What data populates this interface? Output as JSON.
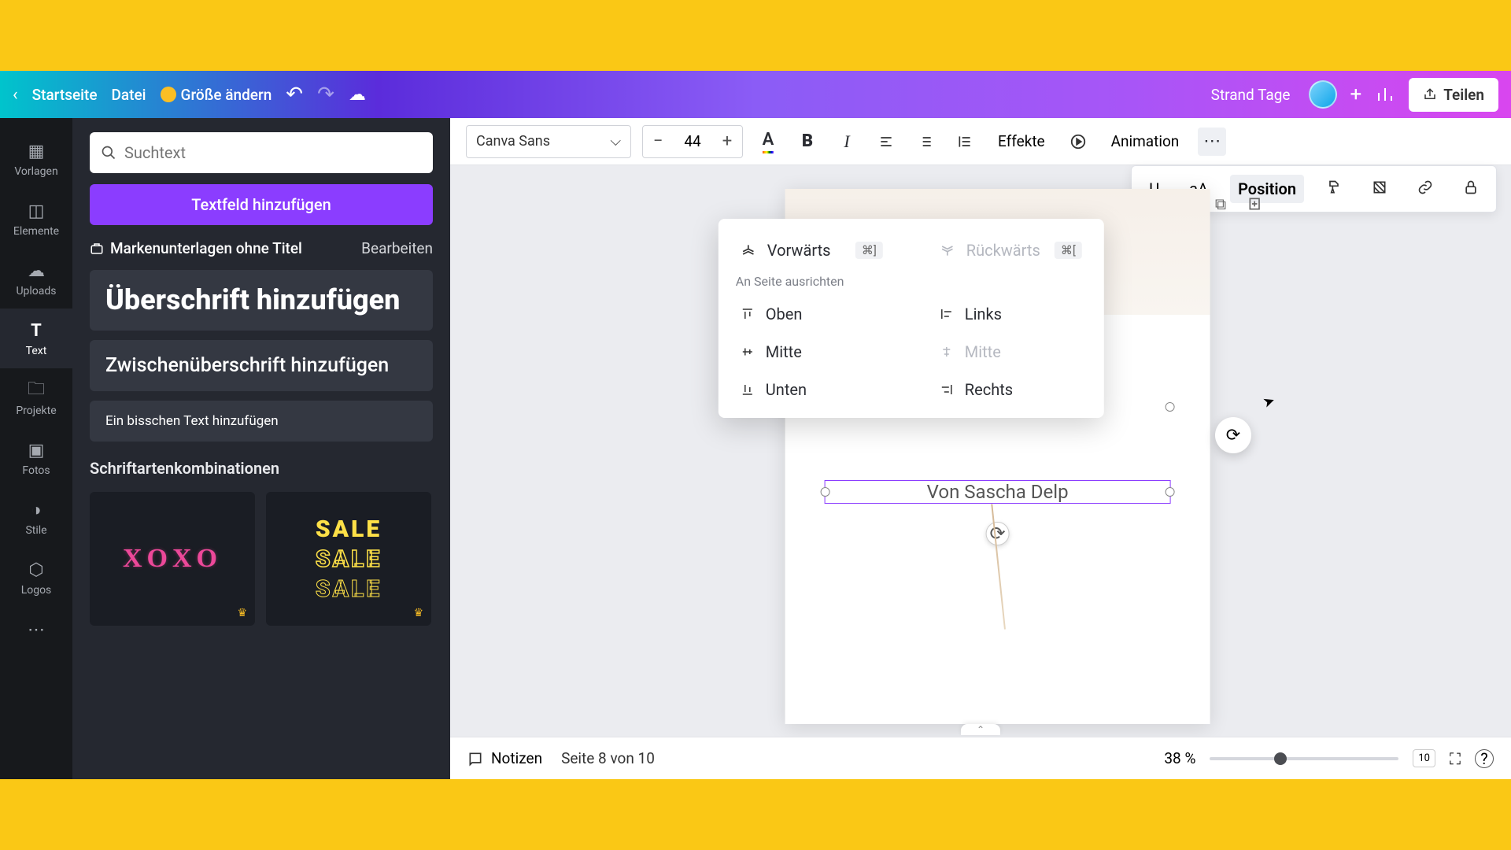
{
  "header": {
    "back_icon": "‹",
    "home": "Startseite",
    "file": "Datei",
    "resize": "Größe ändern",
    "doc_title": "Strand Tage",
    "share": "Teilen"
  },
  "nav": {
    "templates": "Vorlagen",
    "elements": "Elemente",
    "uploads": "Uploads",
    "text": "Text",
    "projects": "Projekte",
    "photos": "Fotos",
    "styles": "Stile",
    "logos": "Logos"
  },
  "side": {
    "search_placeholder": "Suchtext",
    "add_textbox": "Textfeld hinzufügen",
    "brand_docs": "Markenunterlagen ohne Titel",
    "edit": "Bearbeiten",
    "heading": "Überschrift hinzufügen",
    "subheading": "Zwischenüberschrift hinzufügen",
    "body": "Ein bisschen Text hinzufügen",
    "combos_label": "Schriftartenkombinationen",
    "combo1": "XOXO",
    "combo2": "SALE"
  },
  "text_toolbar": {
    "font": "Canva Sans",
    "size": "44",
    "effects": "Effekte",
    "animation": "Animation"
  },
  "secondary": {
    "underline": "U",
    "case": "aA",
    "position": "Position"
  },
  "popup": {
    "forward": "Vorwärts",
    "forward_key": "⌘]",
    "backward": "Rückwärts",
    "backward_key": "⌘[",
    "align_section": "An Seite ausrichten",
    "top": "Oben",
    "left": "Links",
    "middle_v": "Mitte",
    "middle_h": "Mitte",
    "bottom": "Unten",
    "right": "Rechts"
  },
  "canvas": {
    "text_content": "Von Sascha Delp"
  },
  "footer": {
    "notes": "Notizen",
    "page_indicator": "Seite 8 von 10",
    "zoom": "38 %",
    "grid_count": "10"
  }
}
